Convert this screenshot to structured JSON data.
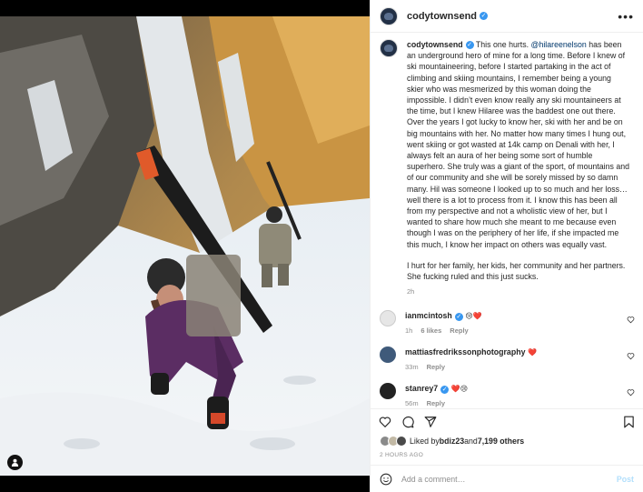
{
  "post": {
    "author": "codytownsend",
    "caption_intro": " This one hurts. ",
    "caption_mention": "@hilareenelson",
    "caption_rest": " has been an underground hero of mine for a long time. Before I knew of ski mountaineering, before I started partaking in the act of climbing and skiing mountains, I remember being a young skier who was mesmerized by this woman doing the impossible. I didn’t even know really any ski mountaineers at the time, but I knew Hilaree was the baddest one out there. Over the years I got lucky to know her, ski with her and be on big mountains with her. No matter how many times I hung out, went skiing or got wasted at 14k camp on Denali with her, I always felt an aura of her being some sort of humble superhero. She truly was a giant of the sport, of mountains and of our community and she will be sorely missed by so damn many. Hil was someone I looked up to so much and her loss…well there is a lot to process from it. I know this has been all from my perspective and not a wholistic view of her, but I wanted to share how much she meant to me because even though I was on the periphery of her life, if she impacted me this much, I know her impact on others was equally vast.",
    "caption_para2": "I hurt for her family, her kids, her community and her partners. She fucking ruled and this just sucks.",
    "caption_time": "2h",
    "liked_by_prefix": "Liked by ",
    "liked_by_user": "bdiz23",
    "liked_by_and": " and ",
    "liked_by_count": "7,199 others",
    "date": "2 HOURS AGO"
  },
  "comments": [
    {
      "user": "ianmcintosh",
      "verified": true,
      "text": " 😢❤️",
      "time": "1h",
      "likes": "6 likes",
      "reply": "Reply"
    },
    {
      "user": "mattiasfredriksson​photography",
      "verified": false,
      "text": " ❤️",
      "time": "33m",
      "likes": "",
      "reply": "Reply"
    },
    {
      "user": "stanrey7",
      "verified": true,
      "text": " ❤️😢",
      "time": "56m",
      "likes": "",
      "reply": "Reply"
    }
  ],
  "add_comment": {
    "placeholder": "Add a comment…",
    "post_label": "Post"
  },
  "colors": {
    "accent": "#3897f0",
    "post_disabled": "#b2dffc",
    "mention": "#00376b"
  },
  "icons": [
    "more-icon",
    "heart-icon",
    "comment-icon",
    "share-icon",
    "save-icon",
    "emoji-icon",
    "user-tag-icon",
    "verified-icon"
  ]
}
